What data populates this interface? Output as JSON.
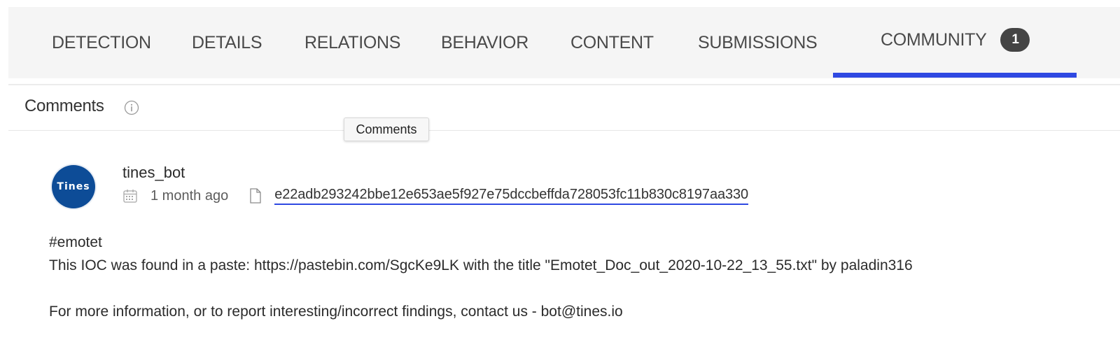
{
  "tabs": [
    {
      "label": "DETECTION"
    },
    {
      "label": "DETAILS"
    },
    {
      "label": "RELATIONS"
    },
    {
      "label": "BEHAVIOR"
    },
    {
      "label": "CONTENT"
    },
    {
      "label": "SUBMISSIONS"
    },
    {
      "label": "COMMUNITY",
      "badge": "1",
      "active": true
    }
  ],
  "section": {
    "title": "Comments",
    "info_icon": "info-icon"
  },
  "tooltip": {
    "text": "Comments"
  },
  "comment": {
    "avatar_text": "Tines",
    "username": "tines_bot",
    "calendar_icon": "calendar-icon",
    "time": "1 month ago",
    "file_icon": "file-icon",
    "hash": "e22adb293242bbe12e653ae5f927e75dccbeffda728053fc11b830c8197aa330",
    "body": {
      "line1": "#emotet",
      "line2": "This IOC was found in a paste: https://pastebin.com/SgcKe9LK with the title \"Emotet_Doc_out_2020-10-22_13_55.txt\" by paladin316",
      "line3": "For more information, or to report interesting/incorrect findings, contact us - bot@tines.io"
    }
  },
  "colors": {
    "accent": "#2f49e2",
    "avatar_bg": "#0d4c97",
    "badge_bg": "#444444",
    "tabbar_bg": "#f5f5f5"
  }
}
